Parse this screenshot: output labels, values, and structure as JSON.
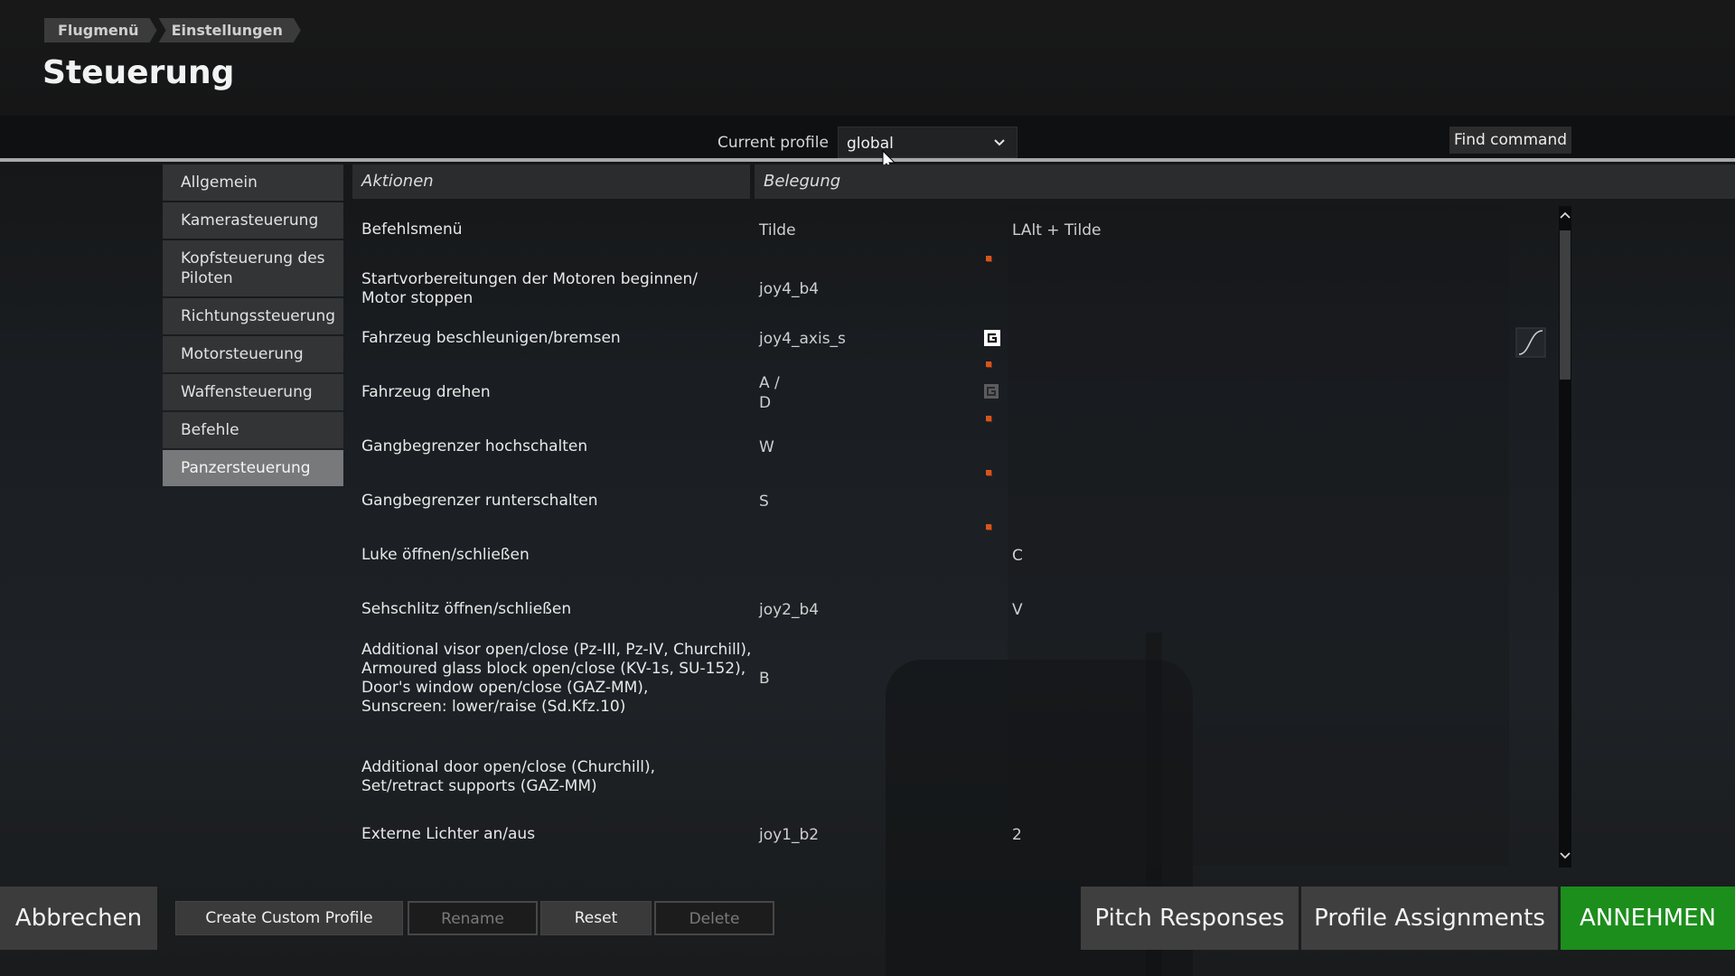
{
  "breadcrumb": [
    "Flugmenü",
    "Einstellungen"
  ],
  "page_title": "Steuerung",
  "profile": {
    "label": "Current profile",
    "selected": "global"
  },
  "find_command": "Find command",
  "sidebar": {
    "items": [
      {
        "label": "Allgemein"
      },
      {
        "label": "Kamerasteuerung"
      },
      {
        "label": "Kopfsteuerung des Piloten"
      },
      {
        "label": "Richtungssteuerung"
      },
      {
        "label": "Motorsteuerung"
      },
      {
        "label": "Waffensteuerung"
      },
      {
        "label": "Befehle"
      },
      {
        "label": "Panzersteuerung"
      }
    ],
    "active": "Panzersteuerung"
  },
  "table": {
    "col_actions": "Aktionen",
    "col_binding": "Belegung",
    "rows": [
      {
        "action": "Befehlsmenü",
        "bind1": "Tilde",
        "bind2": "LAlt + Tilde"
      },
      {
        "action": "Startvorbereitungen der Motoren beginnen/ Motor stoppen",
        "bind1": "joy4_b4",
        "bind2": ""
      },
      {
        "action": "Fahrzeug beschleunigen/bremsen",
        "bind1": "joy4_axis_s",
        "bind2": ""
      },
      {
        "action": "Fahrzeug drehen",
        "bind1": "A /\nD",
        "bind2": ""
      },
      {
        "action": "Gangbegrenzer hochschalten",
        "bind1": "W",
        "bind2": ""
      },
      {
        "action": "Gangbegrenzer runterschalten",
        "bind1": "S",
        "bind2": ""
      },
      {
        "action": "Luke öffnen/schließen",
        "bind1": "",
        "bind2": "C"
      },
      {
        "action": "Sehschlitz öffnen/schließen",
        "bind1": "joy2_b4",
        "bind2": "V"
      },
      {
        "action": "Additional visor open/close (Pz-III, Pz-IV, Churchill),\nArmoured glass block open/close (KV-1s, SU-152),\nDoor's window open/close (GAZ-MM),\nSunscreen: lower/raise (Sd.Kfz.10)",
        "bind1": "B",
        "bind2": ""
      },
      {
        "action": "Additional door open/close (Churchill),\nSet/retract supports (GAZ-MM)",
        "bind1": "",
        "bind2": ""
      },
      {
        "action": "Externe Lichter an/aus",
        "bind1": "joy1_b2",
        "bind2": "2"
      }
    ]
  },
  "footer": {
    "cancel": "Abbrechen",
    "create_profile": "Create Custom Profile",
    "rename": "Rename",
    "reset": "Reset",
    "delete": "Delete",
    "pitch_responses": "Pitch Responses",
    "profile_assignments": "Profile Assignments",
    "accept": "ANNEHMEN"
  },
  "colors": {
    "accent_green": "#1c8e1c",
    "modifier_dot": "#d4561e"
  }
}
